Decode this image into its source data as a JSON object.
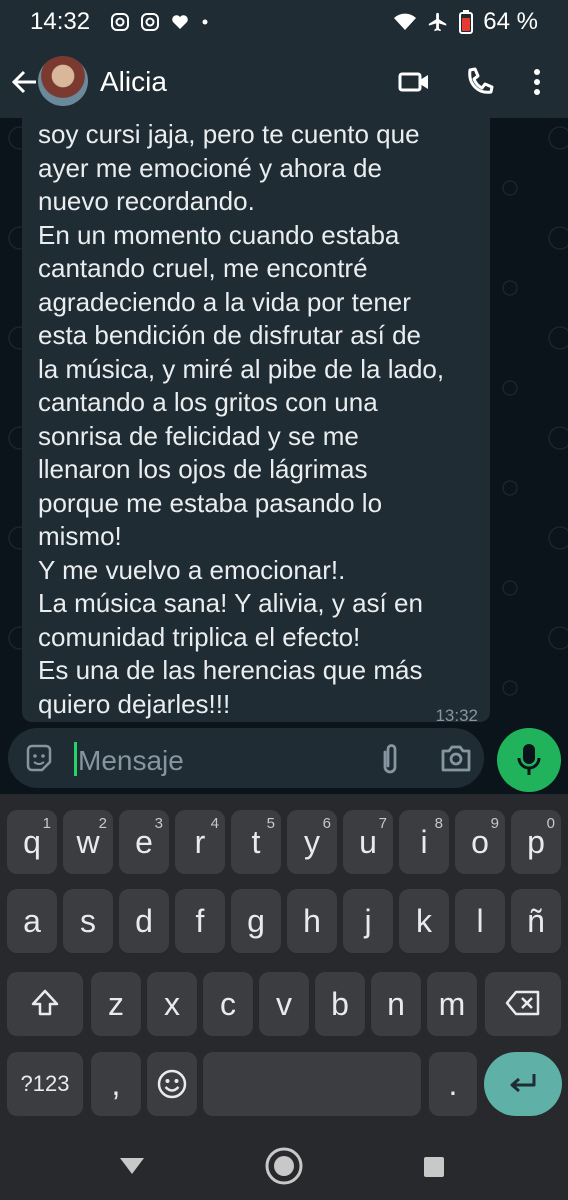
{
  "status_bar": {
    "time": "14:32",
    "battery": "64 %",
    "icons": [
      "instagram-icon",
      "instagram-icon",
      "heart-icon",
      "dot-icon",
      "wifi-icon",
      "airplane-icon",
      "battery-icon"
    ]
  },
  "header": {
    "contact_name": "Alicia",
    "icons": [
      "back-arrow-icon",
      "video-call-icon",
      "phone-icon",
      "more-vert-icon"
    ]
  },
  "message": {
    "text": "soy cursi jaja, pero te cuento que\nayer me emocioné y ahora de\nnuevo recordando.\nEn un momento cuando estaba\ncantando cruel, me encontré\nagradeciendo a la vida por tener\nesta bendición de disfrutar así de\nla música, y miré al pibe de la lado,\ncantando a los gritos con una\nsonrisa de felicidad y se me\nllenaron los ojos de lágrimas\nporque me estaba pasando lo\nmismo!\nY me vuelvo a emocionar!.\nLa música sana! Y alivia, y así en\ncomunidad triplica el efecto!\nEs una de las herencias que más\nquiero dejarles!!!",
    "time": "13:32"
  },
  "composer": {
    "placeholder": "Mensaje",
    "icons": [
      "sticker-icon",
      "attach-icon",
      "camera-icon",
      "mic-icon"
    ]
  },
  "keyboard": {
    "row1": [
      {
        "k": "q",
        "n": "1"
      },
      {
        "k": "w",
        "n": "2"
      },
      {
        "k": "e",
        "n": "3"
      },
      {
        "k": "r",
        "n": "4"
      },
      {
        "k": "t",
        "n": "5"
      },
      {
        "k": "y",
        "n": "6"
      },
      {
        "k": "u",
        "n": "7"
      },
      {
        "k": "i",
        "n": "8"
      },
      {
        "k": "o",
        "n": "9"
      },
      {
        "k": "p",
        "n": "0"
      }
    ],
    "row2": [
      "a",
      "s",
      "d",
      "f",
      "g",
      "h",
      "j",
      "k",
      "l",
      "ñ"
    ],
    "row3": [
      "z",
      "x",
      "c",
      "v",
      "b",
      "n",
      "m"
    ],
    "symbols_label": "?123",
    "comma": ",",
    "period": "."
  },
  "colors": {
    "accent_green": "#21b35b",
    "enter_key": "#5fb1a7",
    "bubble": "#202c33"
  }
}
